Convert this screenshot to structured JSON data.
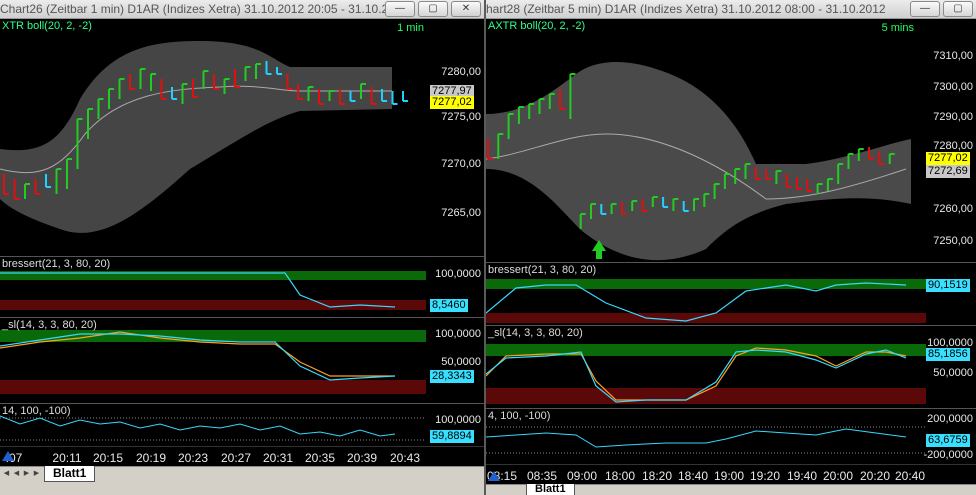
{
  "left": {
    "title": "Chart26 (Zeitbar 1 min)  D1AR (Indizes Xetra) 31.10.2012 20:05 - 31.10.2",
    "price_label": "XTR boll(20, 2, -2)",
    "timeframe": "1 min",
    "yticks": [
      "7280,00",
      "7275,00",
      "7270,00",
      "7265,00"
    ],
    "tag_a": "7277,97",
    "tag_b": "7277,02",
    "ind1_label": "bressert(21, 3, 80, 20)",
    "ind1_ticks": [
      "100,0000"
    ],
    "ind1_tag": "8,5460",
    "ind2_label": "_sl(14, 3, 3, 80, 20)",
    "ind2_ticks": [
      "100,0000",
      "50,0000"
    ],
    "ind2_tag": "28,3343",
    "ind3_label": "14, 100, -100)",
    "ind3_ticks": [
      "100,0000"
    ],
    "ind3_tag": "59,8894",
    "xlabels": [
      ":07",
      "20:11",
      "20:15",
      "20:19",
      "20:23",
      "20:27",
      "20:31",
      "20:35",
      "20:39",
      "20:43"
    ],
    "sheet": "Blatt1"
  },
  "right": {
    "title": "hart28 (Zeitbar 5 min)  D1AR (Indizes Xetra) 31.10.2012 08:00 - 31.10.2012",
    "price_label": "AXTR boll(20, 2, -2)",
    "timeframe": "5 mins",
    "yticks": [
      "7310,00",
      "7300,00",
      "7290,00",
      "7280,00",
      "7270,00",
      "7260,00",
      "7250,00"
    ],
    "tag_a": "7277,02",
    "tag_b": "7272,69",
    "ind1_label": "bressert(21, 3, 80, 20)",
    "ind1_tag": "90,1519",
    "ind2_label": "_sl(14, 3, 3, 80, 20)",
    "ind2_ticks": [
      "100,0000",
      "50,0000"
    ],
    "ind2_tag": "85,1856",
    "ind3_label": "4, 100, -100)",
    "ind3_ticks": [
      "200,0000",
      "-200,0000"
    ],
    "ind3_tag": "63,6759",
    "xlabels": [
      "08:15",
      "08:35",
      "09:00",
      "18:00",
      "18:20",
      "18:40",
      "19:00",
      "19:20",
      "19:40",
      "20:00",
      "20:20",
      "20:40"
    ],
    "sheet": "Blatt1"
  },
  "colors": {
    "up": "#22cc22",
    "down": "#e01010",
    "doji": "#22d0ff",
    "band": "#4a4a4a",
    "green_zone": "#0a6a0a",
    "red_zone": "#5a0808",
    "line_cyan": "#38d8ff",
    "line_orange": "#ffa020",
    "tag_yellow": "#ffff00",
    "tag_cyan": "#38e0ff"
  },
  "window_buttons": [
    "minimize-icon",
    "restore-icon",
    "close-icon"
  ]
}
